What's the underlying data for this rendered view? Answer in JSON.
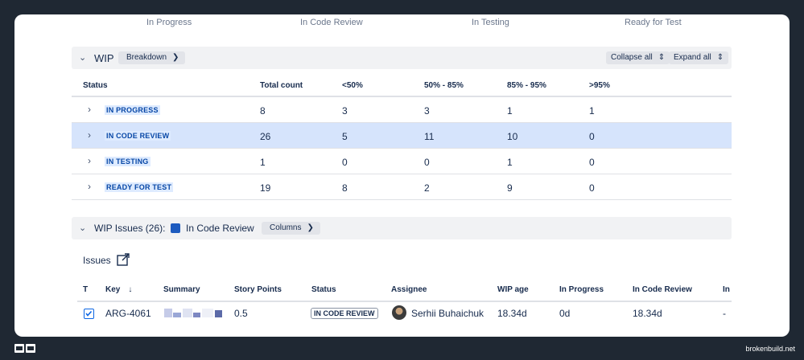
{
  "column_headers": [
    "In Progress",
    "In Code Review",
    "In Testing",
    "Ready for Test"
  ],
  "wip_panel": {
    "title": "WIP",
    "breakdown_label": "Breakdown",
    "collapse_label": "Collapse all",
    "expand_label": "Expand all"
  },
  "summary_table": {
    "headers": [
      "Status",
      "Total count",
      "<50%",
      "50% - 85%",
      "85% - 95%",
      ">95%"
    ],
    "rows": [
      {
        "status": "IN PROGRESS",
        "total": "8",
        "lt50": "3",
        "p50_85": "3",
        "p85_95": "1",
        "gt95": "1"
      },
      {
        "status": "IN CODE REVIEW",
        "total": "26",
        "lt50": "5",
        "p50_85": "11",
        "p85_95": "10",
        "gt95": "0"
      },
      {
        "status": "IN TESTING",
        "total": "1",
        "lt50": "0",
        "p50_85": "0",
        "p85_95": "1",
        "gt95": "0"
      },
      {
        "status": "READY FOR TEST",
        "total": "19",
        "lt50": "8",
        "p50_85": "2",
        "p85_95": "9",
        "gt95": "0"
      }
    ],
    "selected_row": 1
  },
  "wip_issues_panel": {
    "title": "WIP Issues (26):",
    "status_name": "In Code Review",
    "status_color": "#1d5bbf",
    "columns_label": "Columns"
  },
  "issues": {
    "heading": "Issues",
    "headers": [
      "T",
      "Key",
      "Summary",
      "Story Points",
      "Status",
      "Assignee",
      "WIP age",
      "In Progress",
      "In Code Review",
      "In"
    ],
    "row": {
      "key": "ARG-4061",
      "story_points": "0.5",
      "status": "IN CODE REVIEW",
      "assignee": "Serhii Buhaichuk",
      "wip_age": "18.34d",
      "in_progress": "0d",
      "in_code_review": "18.34d",
      "in_next": "-"
    }
  },
  "footer": {
    "brand": "brokenbuild.net"
  },
  "colors": {
    "background": "#1f2833",
    "selected_row": "#d6e4fc",
    "lozenge_text": "#0747a6"
  }
}
